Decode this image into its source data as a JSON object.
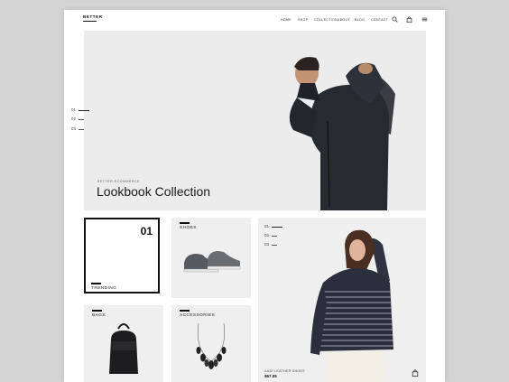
{
  "brand": {
    "logo": "BETTER"
  },
  "nav": {
    "items": [
      "HOME",
      "SHOP",
      "COLLECTION",
      "ABOUT",
      "BLOG",
      "CONTACT"
    ],
    "icons": [
      "search-icon",
      "bag-icon",
      "menu-icon"
    ]
  },
  "hero": {
    "pager": [
      "01",
      "02",
      "03"
    ],
    "kicker": "BETTER ECOMMERCE",
    "title": "Lookbook Collection"
  },
  "tiles": {
    "trending": {
      "number": "01",
      "label": "TRENDING"
    },
    "shoes": {
      "label": "SHOES"
    },
    "bags": {
      "label": "BAGS"
    },
    "accessories": {
      "label": "ACCESSORIES"
    }
  },
  "feature": {
    "pager": [
      "01",
      "02",
      "03"
    ],
    "product_name": "AUDI LEATHER SHOES",
    "price": "$67.05"
  }
}
